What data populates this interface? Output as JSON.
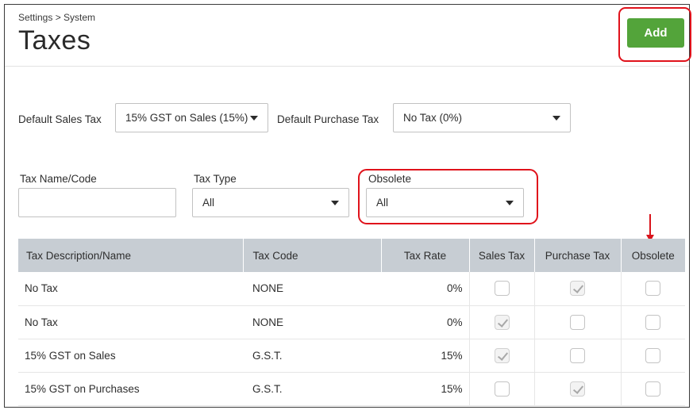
{
  "header": {
    "breadcrumb": "Settings > System",
    "title": "Taxes",
    "add_label": "Add"
  },
  "defaults": {
    "sales_tax_label": "Default Sales Tax",
    "sales_tax_value": "15% GST on Sales (15%)",
    "purchase_tax_label": "Default Purchase Tax",
    "purchase_tax_value": "No Tax (0%)"
  },
  "filters": {
    "name_label": "Tax Name/Code",
    "name_value": "",
    "type_label": "Tax Type",
    "type_value": "All",
    "obsolete_label": "Obsolete",
    "obsolete_value": "All"
  },
  "table": {
    "headers": [
      "Tax Description/Name",
      "Tax Code",
      "Tax Rate",
      "Sales Tax",
      "Purchase Tax",
      "Obsolete"
    ],
    "rows": [
      {
        "name": "No Tax",
        "code": "NONE",
        "rate": "0%",
        "sales": false,
        "purchase": true,
        "obsolete": false
      },
      {
        "name": "No Tax",
        "code": "NONE",
        "rate": "0%",
        "sales": true,
        "purchase": false,
        "obsolete": false
      },
      {
        "name": "15% GST on Sales",
        "code": "G.S.T.",
        "rate": "15%",
        "sales": true,
        "purchase": false,
        "obsolete": false
      },
      {
        "name": "15% GST on Purchases",
        "code": "G.S.T.",
        "rate": "15%",
        "sales": false,
        "purchase": true,
        "obsolete": false
      }
    ]
  },
  "colors": {
    "accent_green": "#53a43a",
    "highlight_red": "#e0121b",
    "table_header_bg": "#c7cdd3"
  }
}
